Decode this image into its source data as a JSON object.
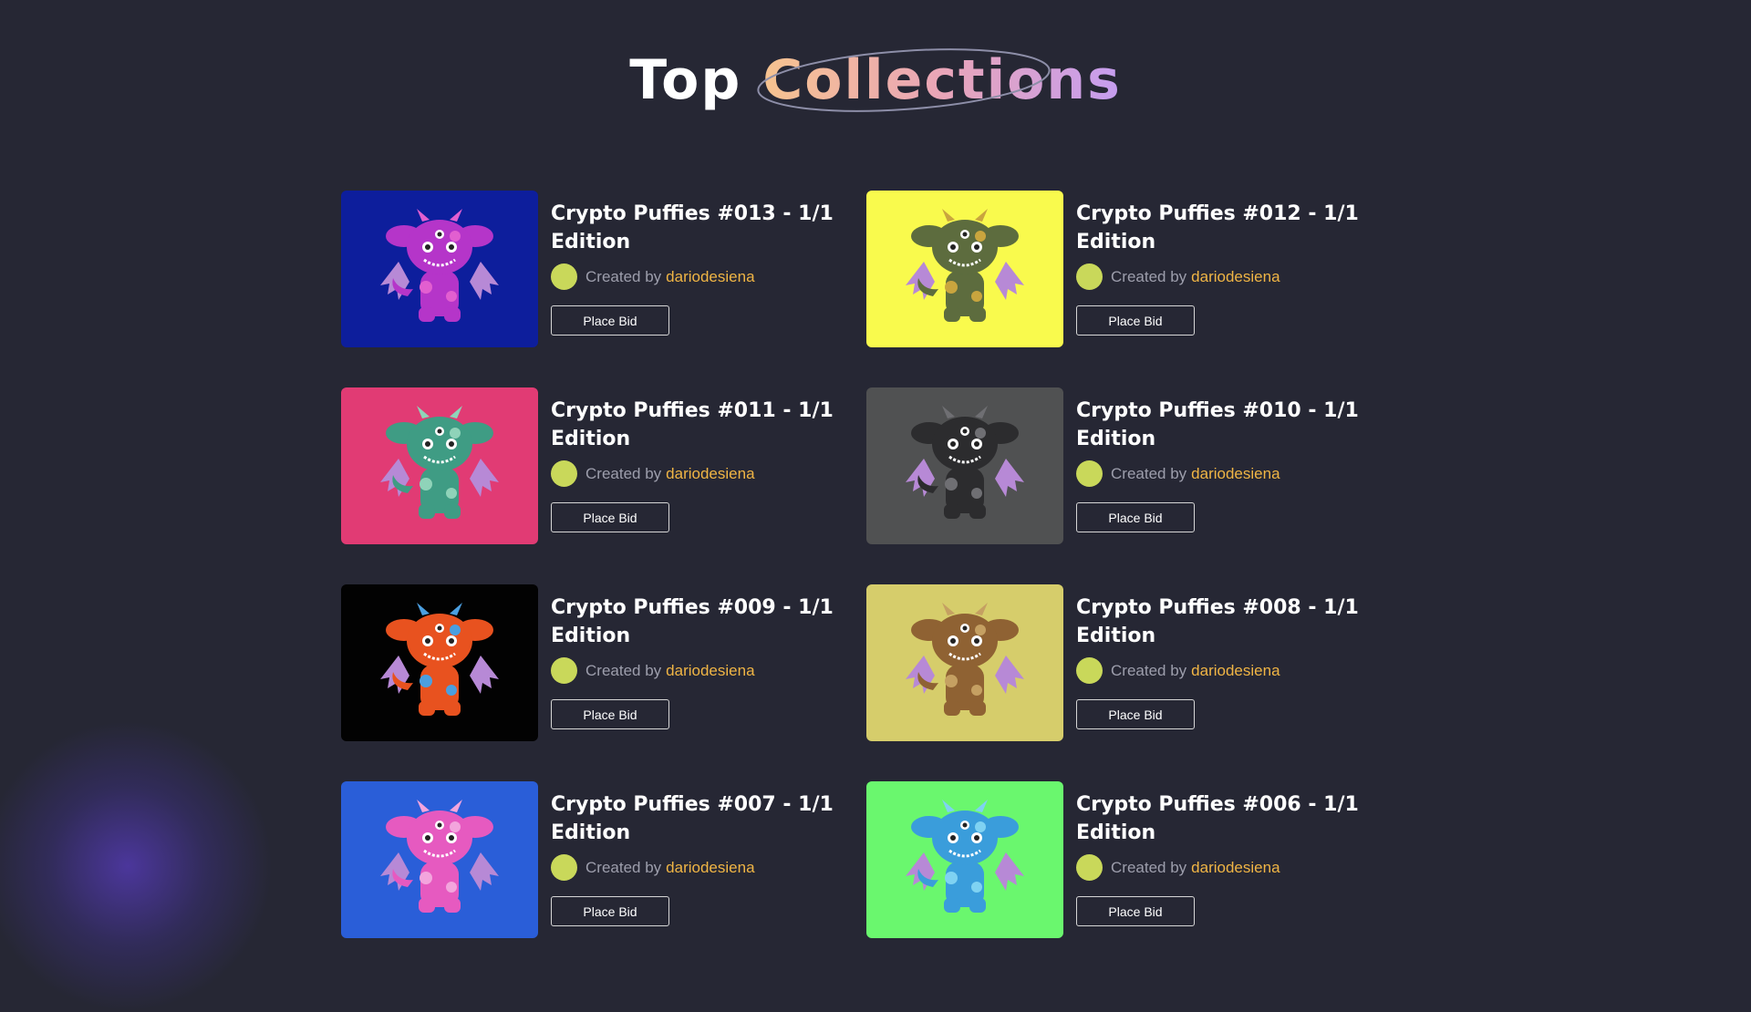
{
  "heading": {
    "prefix": "Top",
    "highlight": "Collections"
  },
  "creator_label": "Created by",
  "bid_label": "Place Bid",
  "items": [
    {
      "title": "Crypto Puffies #013 - 1/1 Edition",
      "creator": "dariodesiena",
      "bg": "#0d1e9c",
      "body": "#b535c9",
      "accent": "#e25fd0"
    },
    {
      "title": "Crypto Puffies #012 - 1/1 Edition",
      "creator": "dariodesiena",
      "bg": "#f9fa4d",
      "body": "#5d6c3e",
      "accent": "#c9a53e"
    },
    {
      "title": "Crypto Puffies #011 - 1/1 Edition",
      "creator": "dariodesiena",
      "bg": "#e13b74",
      "body": "#3f9c84",
      "accent": "#8fd3b9"
    },
    {
      "title": "Crypto Puffies #010 - 1/1 Edition",
      "creator": "dariodesiena",
      "bg": "#505152",
      "body": "#2c2c2e",
      "accent": "#6f6f73"
    },
    {
      "title": "Crypto Puffies #009 - 1/1 Edition",
      "creator": "dariodesiena",
      "bg": "#020202",
      "body": "#e8521f",
      "accent": "#4b9fe0"
    },
    {
      "title": "Crypto Puffies #008 - 1/1 Edition",
      "creator": "dariodesiena",
      "bg": "#d6cd6b",
      "body": "#8f6233",
      "accent": "#c5a062"
    },
    {
      "title": "Crypto Puffies #007 - 1/1 Edition",
      "creator": "dariodesiena",
      "bg": "#2a5ed8",
      "body": "#e65ac0",
      "accent": "#f3a5dd"
    },
    {
      "title": "Crypto Puffies #006 - 1/1 Edition",
      "creator": "dariodesiena",
      "bg": "#6af76e",
      "body": "#3a9ddb",
      "accent": "#7fd2f2"
    }
  ]
}
